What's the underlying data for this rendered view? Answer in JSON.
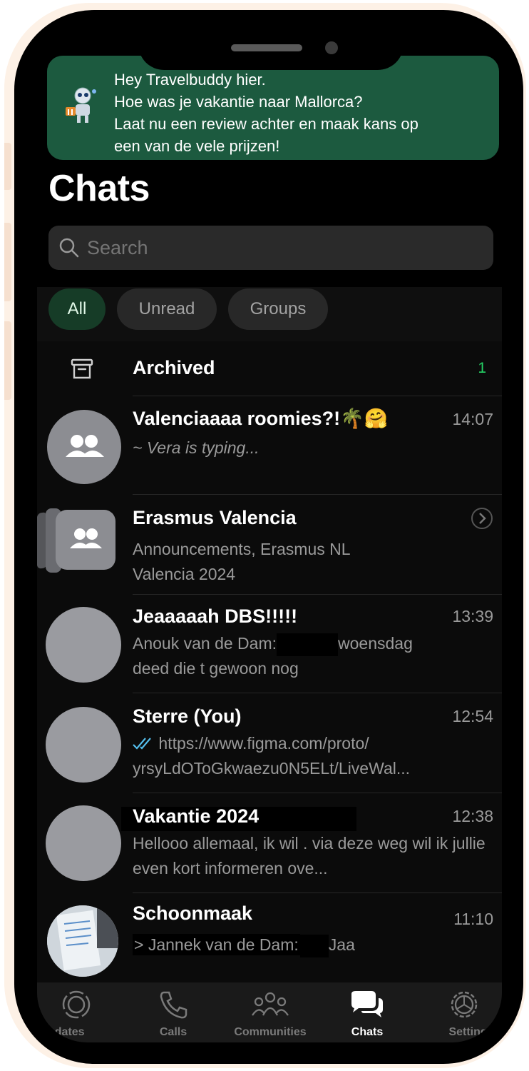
{
  "banner": {
    "lines": [
      "Hey Travelbuddy hier.",
      "Hoe was je vakantie naar Mallorca?",
      "Laat nu een review achter en maak kans op",
      "een van de vele  prijzen!"
    ]
  },
  "page_title": "Chats",
  "search": {
    "placeholder": "Search"
  },
  "filters": [
    "All",
    "Unread",
    "Groups"
  ],
  "archived": {
    "label": "Archived",
    "count": "1"
  },
  "chats": [
    {
      "title": "Valenciaaaa roomies?!🌴🤗",
      "time": "14:07",
      "subtitle": "~ Vera is typing..."
    },
    {
      "title": "Erasmus Valencia",
      "subtitle": "Announcements, Erasmus NL Valencia 2024"
    },
    {
      "title": "Jeaaaaah DBS!!!!!",
      "time": "13:39",
      "sender": "Anouk van de Dam:",
      "text1": "woensdag",
      "text2": "deed die t gewoon nog"
    },
    {
      "title": "Sterre (You)",
      "time": "12:54",
      "line1": "https://www.figma.com/proto/",
      "line2": "yrsyLdOToGkwaezu0N5ELt/LiveWal..."
    },
    {
      "title": "Vakantie 2024",
      "time": "12:38",
      "subtitle": "Hellooo allemaal,  ik wil . via deze weg wil ik jullie even kort informeren ove..."
    },
    {
      "title": "Schoonmaak",
      "time": "11:10",
      "sender": "> Jannek van de Dam:",
      "text": "Jaa"
    }
  ],
  "tabs": [
    "Updates",
    "Calls",
    "Communities",
    "Chats",
    "Settings"
  ],
  "colors": {
    "accent": "#25d366",
    "banner": "#1c5a3f",
    "read_ticks": "#53bdeb"
  }
}
